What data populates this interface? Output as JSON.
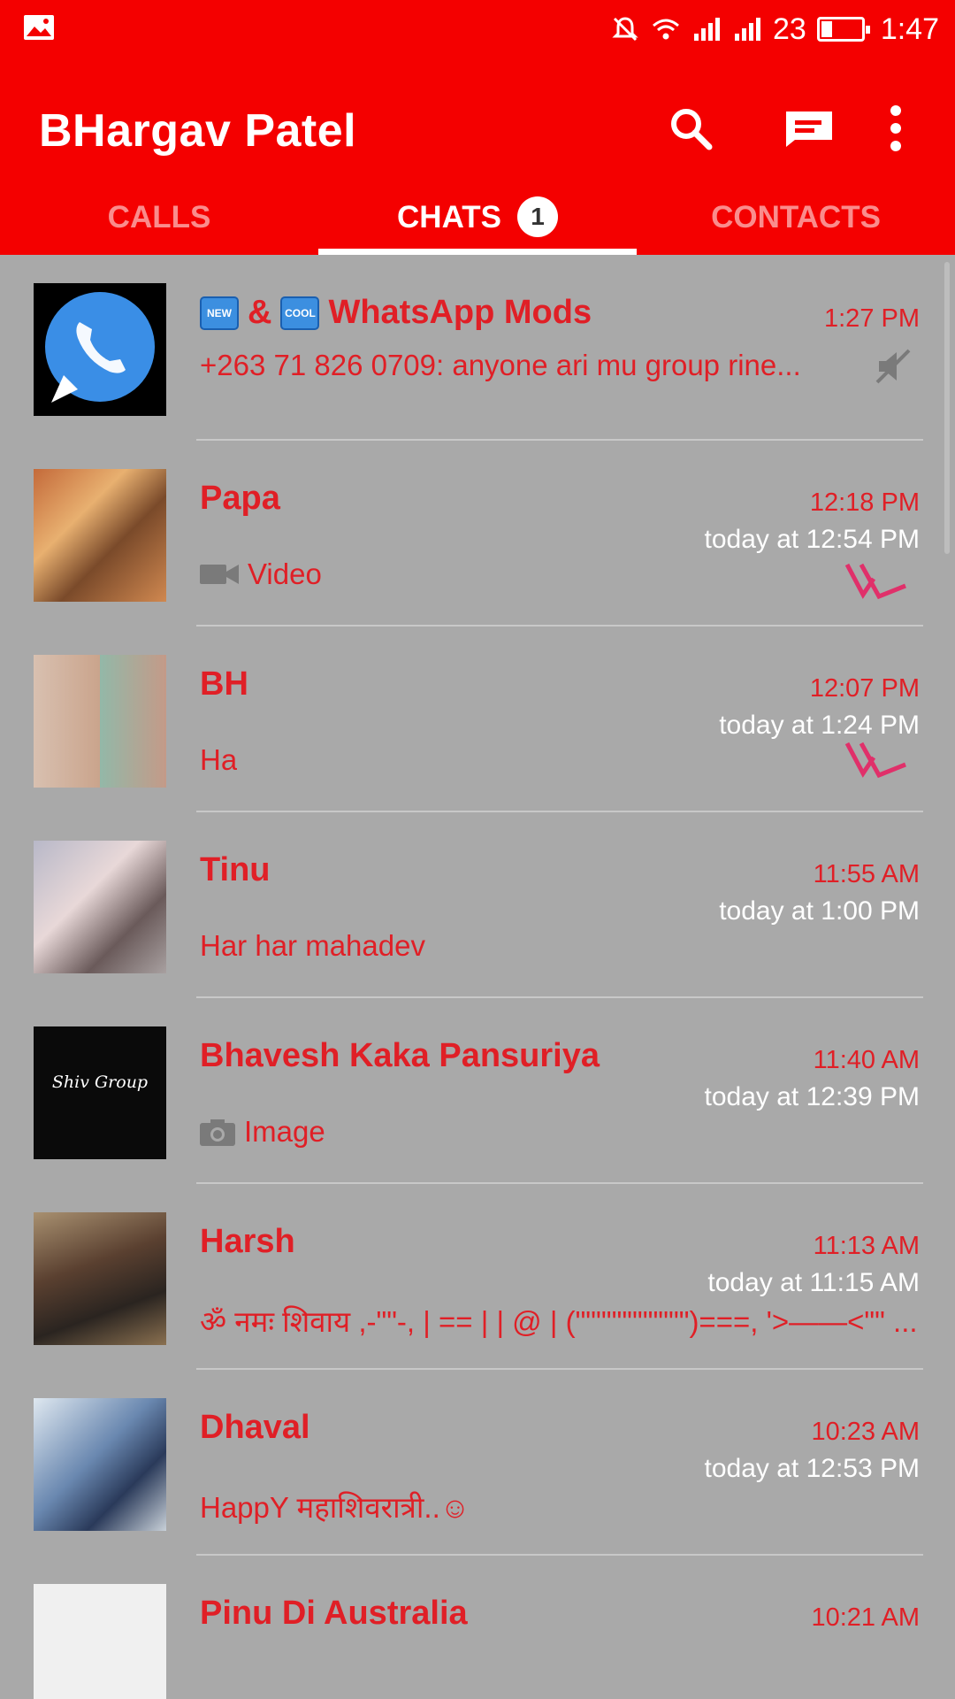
{
  "status_bar": {
    "signal_label": "23",
    "time": "1:47"
  },
  "app_bar": {
    "title": "BHargav Patel",
    "icons": [
      "search-icon",
      "new-chat-icon",
      "more-vert-icon"
    ]
  },
  "tabs": [
    {
      "label": "CALLS",
      "active": false
    },
    {
      "label": "CHATS",
      "active": true,
      "badge": "1"
    },
    {
      "label": "CONTACTS",
      "active": false
    }
  ],
  "chats": [
    {
      "name_prefix_1": "NEW",
      "name_amp": "&",
      "name_prefix_2": "COOL",
      "name": "WhatsApp Mods",
      "time": "1:27 PM",
      "subtime": "",
      "preview": "+263 71 826 0709: anyone ari mu group rine...",
      "muted": true
    },
    {
      "name": "Papa",
      "time": "12:18 PM",
      "subtime": "today at 12:54 PM",
      "preview": "Video",
      "preview_icon": "video-icon"
    },
    {
      "name": "BH",
      "time": "12:07 PM",
      "subtime": "today at 1:24 PM",
      "preview": "Ha"
    },
    {
      "name": "Tinu",
      "time": "11:55 AM",
      "subtime": "today at 1:00 PM",
      "preview": "Har har mahadev"
    },
    {
      "name": "Bhavesh Kaka Pansuriya",
      "time": "11:40 AM",
      "subtime": "today at 12:39 PM",
      "preview": "Image",
      "preview_icon": "camera-icon",
      "avatar_text": "Shiv Group"
    },
    {
      "name": "Harsh",
      "time": "11:13 AM",
      "subtime": "today at 11:15 AM",
      "preview": "ॐ नमः शिवाय ,-\"\"-, | == | | @ | (\"\"\"\"\"\"\"\"\"\"\")===, '>——<\"\" ..."
    },
    {
      "name": "Dhaval",
      "time": "10:23 AM",
      "subtime": "today at 12:53 PM",
      "preview": "HappY महाशिवरात्री..☺"
    },
    {
      "name": "Pinu Di Australia",
      "time": "10:21 AM",
      "subtime": "",
      "preview": ""
    }
  ],
  "colors": {
    "primary": "#f40000",
    "list_bg": "#a9a9a9",
    "name_red": "#e01f26",
    "tick_pink": "#e0306a"
  }
}
